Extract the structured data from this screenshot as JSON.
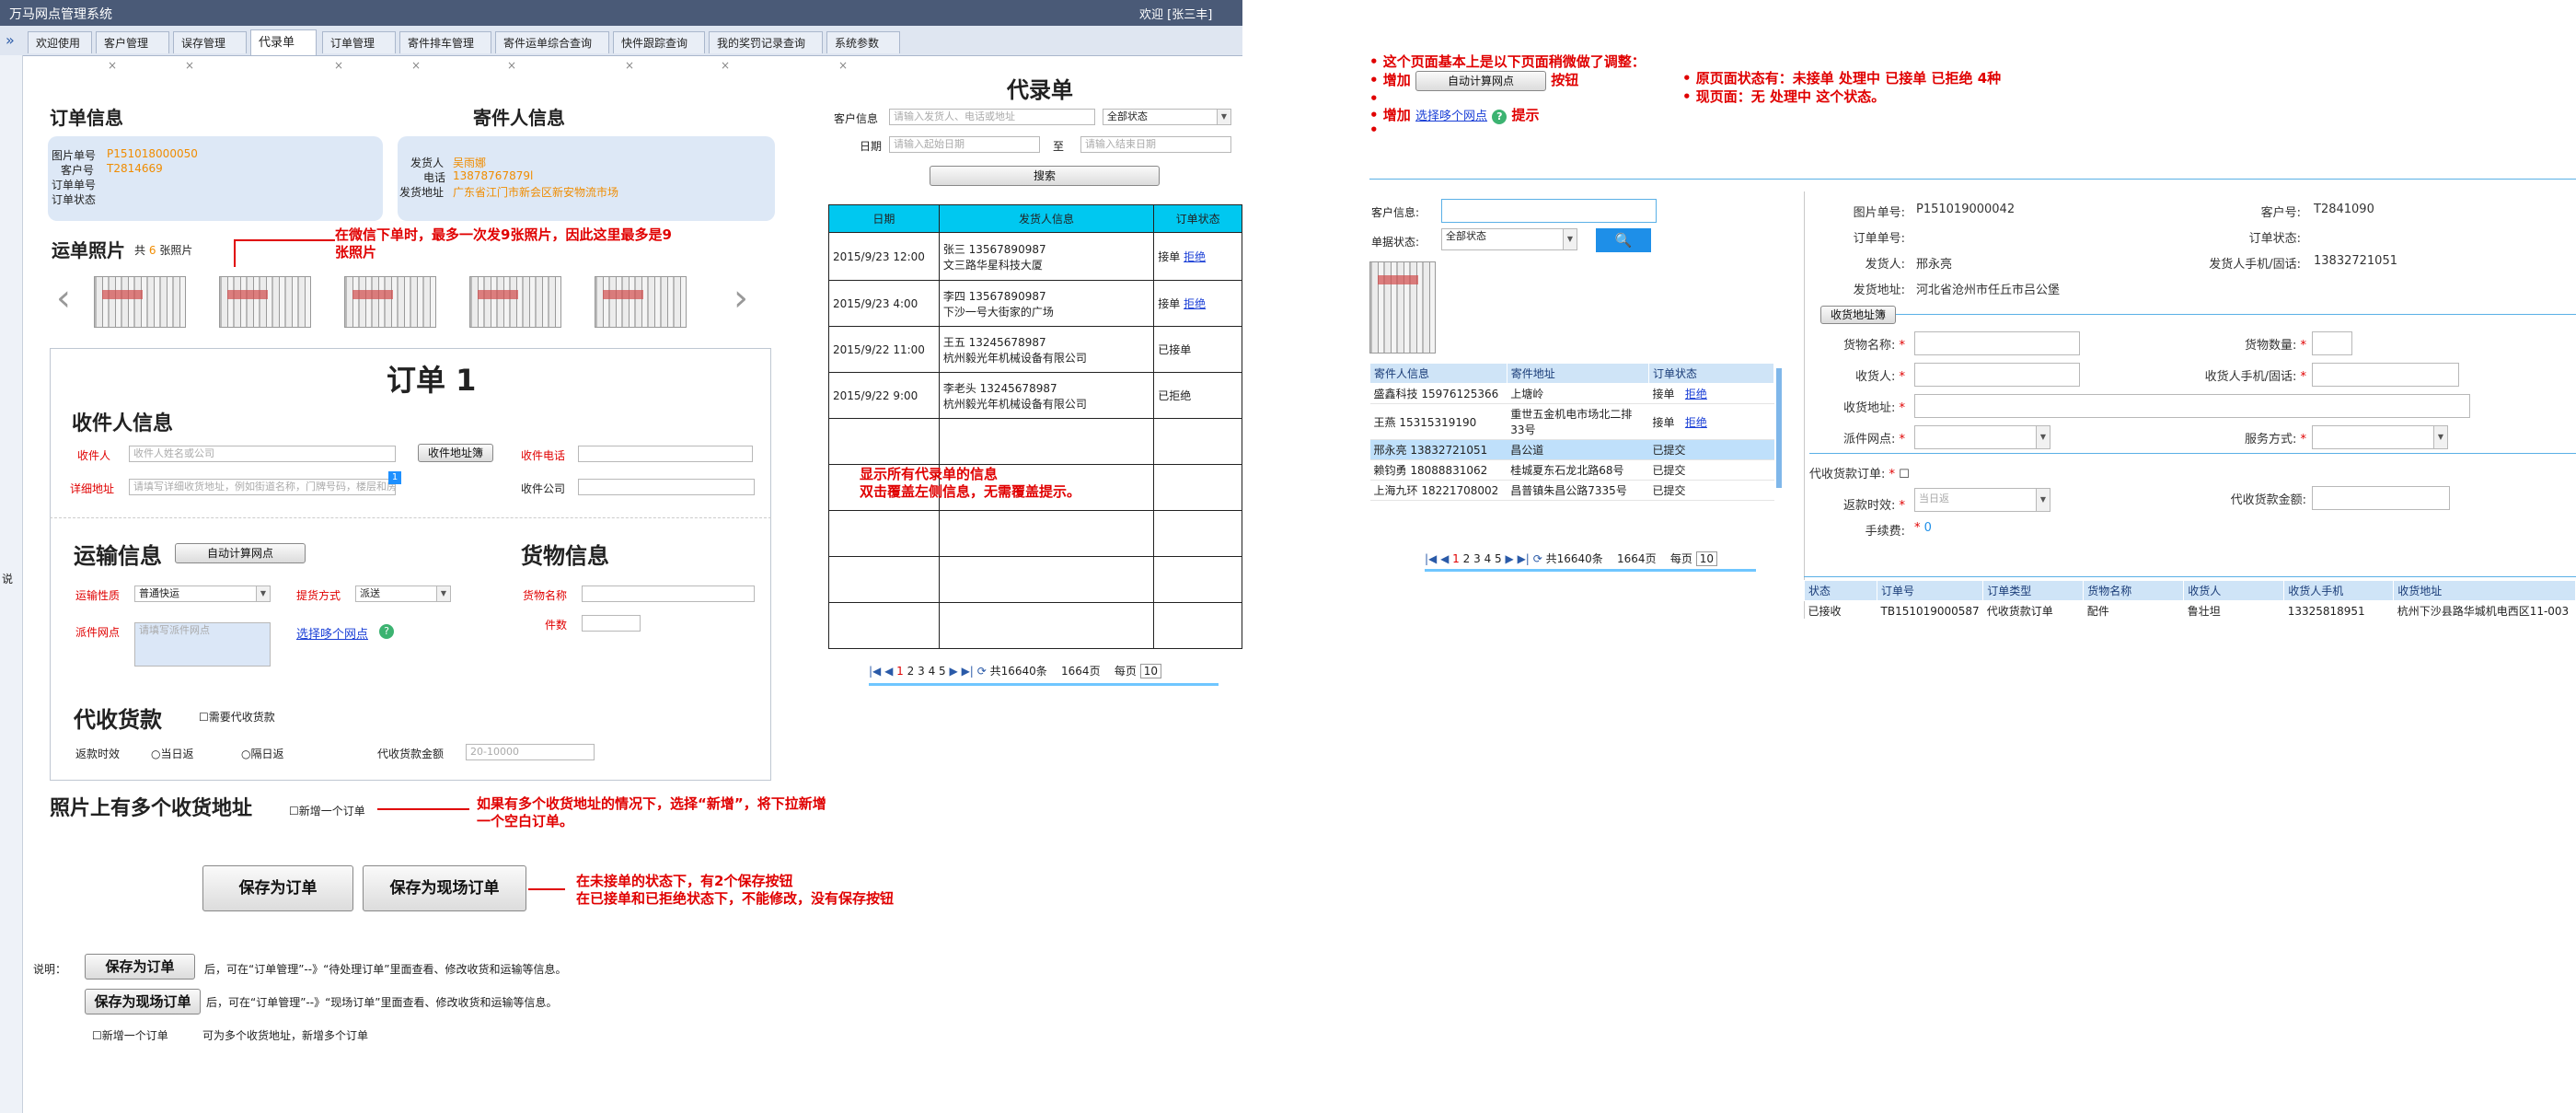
{
  "header": {
    "app_title": "万马网点管理系统",
    "welcome": "欢迎 [张三丰]"
  },
  "tabs": [
    {
      "label": "欢迎使用",
      "close": false
    },
    {
      "label": "客户管理",
      "close": true
    },
    {
      "label": "误存管理",
      "close": true
    },
    {
      "label": "代录单",
      "close": false,
      "active": true
    },
    {
      "label": "订单管理",
      "close": true
    },
    {
      "label": "寄件排车管理",
      "close": true
    },
    {
      "label": "寄件运单综合查询",
      "close": true
    },
    {
      "label": "快件跟踪查询",
      "close": true
    },
    {
      "label": "我的奖罚记录查询",
      "close": true
    },
    {
      "label": "系统参数",
      "close": true
    }
  ],
  "left_strip": {
    "toggle": "»",
    "label": "说"
  },
  "order_info": {
    "title": "订单信息",
    "rows": [
      {
        "label": "图片单号",
        "value": "P151018000050"
      },
      {
        "label": "客户号",
        "value": "T2814669"
      },
      {
        "label": "订单单号",
        "value": ""
      },
      {
        "label": "订单状态",
        "value": ""
      }
    ]
  },
  "sender_info": {
    "title": "寄件人信息",
    "rows": [
      {
        "label": "发货人",
        "value": "吴雨娜"
      },
      {
        "label": "电话",
        "value": "13878767879l"
      },
      {
        "label": "发货地址",
        "value": "广东省江门市新会区新安物流市场"
      }
    ]
  },
  "photos": {
    "title": "运单照片",
    "count_prefix": "共",
    "count": "6",
    "count_suffix": "张照片",
    "prev": "‹",
    "next": "›"
  },
  "annotations": {
    "photos_note": "在微信下单时，最多一次发9张照片，因此这里最多是9张照片",
    "list_note": "显示所有代录单的信息\n双击覆盖左侧信息，无需覆盖提示。",
    "multi_addr_note": "如果有多个收货地址的情况下，选择“新增”，将下拉新增一个空白订单。",
    "save_note": "在未接单的状态下，有2个保存按钮\n在已接单和已拒绝状态下，不能修改，没有保存按钮"
  },
  "order_form": {
    "title": "订单 1",
    "receiver": {
      "title": "收件人信息",
      "name_label": "收件人",
      "name_ph": "收件人姓名或公司",
      "addr_book_btn": "收件地址簿",
      "phone_label": "收件电话",
      "addr_label": "详细地址",
      "addr_ph": "请填写详细收货地址，例如街道名称，门牌号码，楼层和房间号等信息",
      "addr_badge": "1",
      "company_label": "收件公司"
    },
    "transport": {
      "title": "运输信息",
      "calc_btn": "自动计算网点",
      "nature_label": "运输性质",
      "nature_value": "普通快运",
      "pickup_label": "提货方式",
      "pickup_value": "派送",
      "dispatch_label": "派件网点",
      "dispatch_ph": "请填写派件网点",
      "multi_link": "选择哆个网点",
      "help_icon": "?"
    },
    "goods": {
      "title": "货物信息",
      "name_label": "货物名称",
      "qty_label": "件数"
    },
    "cod": {
      "title": "代收货款",
      "need_label": "需要代收货款",
      "return_label": "返款时效",
      "opt1": "当日返",
      "opt2": "隔日返",
      "amount_label": "代收货款金额",
      "amount_ph": "20-10000"
    }
  },
  "multi_addr": {
    "title": "照片上有多个收货地址",
    "check_label": "新增一个订单"
  },
  "buttons": {
    "save_order": "保存为订单",
    "save_onsite": "保存为现场订单"
  },
  "explain": {
    "label": "说明：",
    "btn1": "保存为订单",
    "text1": "后，可在“订单管理”--》“待处理订单”里面查看、修改收货和运输等信息。",
    "btn2": "保存为现场订单",
    "text2": "后，可在“订单管理”--》“现场订单”里面查看、修改收货和运输等信息。",
    "check": "新增一个订单",
    "text3": "可为多个收货地址，新增多个订单"
  },
  "list_panel": {
    "title": "代录单",
    "customer_label": "客户信息",
    "customer_ph": "请输入发货人、电话或地址",
    "status_value": "全部状态",
    "date_label": "日期",
    "date_start_ph": "请输入起始日期",
    "to": "至",
    "date_end_ph": "请输入结束日期",
    "search_btn": "搜索",
    "columns": [
      "日期",
      "发货人信息",
      "订单状态"
    ],
    "rows": [
      {
        "date": "2015/9/23 12:00",
        "line1": "张三 13567890987",
        "line2": "文三路华星科技大厦",
        "status": "接单",
        "reject": "拒绝"
      },
      {
        "date": "2015/9/23 4:00",
        "line1": "李四 13567890987",
        "line2": "下沙一号大街家的广场",
        "status": "接单",
        "reject": "拒绝"
      },
      {
        "date": "2015/9/22 11:00",
        "line1": "王五 13245678987",
        "line2": "杭州毅光年机械设备有限公司",
        "status": "已接单",
        "reject": ""
      },
      {
        "date": "2015/9/22 9:00",
        "line1": "李老头 13245678987",
        "line2": "杭州毅光年机械设备有限公司",
        "status": "已拒绝",
        "reject": ""
      }
    ],
    "pager": {
      "pages": [
        "1",
        "2",
        "3",
        "4",
        "5"
      ],
      "total": "共16640条",
      "page_count": "1664页",
      "per_page_label": "每页",
      "per_page": "10"
    }
  },
  "right_notes": {
    "note1": "• 这个页面基本上是以下页面稍微做了调整：",
    "note2_prefix": "• 增加",
    "note2_btn": "自动计算网点",
    "note2_suffix": "按钮",
    "note3": "•",
    "note4_prefix": "• 增加",
    "note4_link": "选择哆个网点",
    "note4_suffix": "提示",
    "note5": "•",
    "note6": "• 原页面状态有：未接单 处理中 已接单 已拒绝 4种",
    "note7": "• 现页面：无 处理中 这个状态。"
  },
  "old_page": {
    "customer_label": "客户信息:",
    "status_label": "单据状态:",
    "status_value": "全部状态",
    "columns": [
      "寄件人信息",
      "寄件地址",
      "订单状态"
    ],
    "rows": [
      {
        "info": "盛鑫科技 15976125366",
        "addr": "上塘岭",
        "status": "接单",
        "reject": "拒绝"
      },
      {
        "info": "王燕 15315319190",
        "addr": "重世五金机电市场北二排33号",
        "status": "接单",
        "reject": "拒绝"
      },
      {
        "info": "邢永亮 13832721051",
        "addr": "昌公道",
        "status": "已提交",
        "reject": ""
      },
      {
        "info": "赖钧勇 18088831062",
        "addr": "桂城夏东石龙北路68号",
        "status": "已提交",
        "reject": ""
      },
      {
        "info": "上海九环 18221708002",
        "addr": "昌普镇朱昌公路7335号",
        "status": "已提交",
        "reject": ""
      }
    ],
    "pager": {
      "pages": [
        "1",
        "2",
        "3",
        "4",
        "5"
      ],
      "total": "共16640条",
      "page_count": "1664页",
      "per_page_label": "每页",
      "per_page": "10"
    },
    "detail": {
      "pic_no_label": "图片单号:",
      "pic_no": "P151019000042",
      "cust_label": "客户号:",
      "cust": "T2841090",
      "order_no_label": "订单单号:",
      "order_status_label": "订单状态:",
      "sender_label": "发货人:",
      "sender": "邢永亮",
      "sender_phone_label": "发货人手机/固话:",
      "sender_phone": "13832721051",
      "sender_addr_label": "发货地址:",
      "sender_addr": "河北省沧州市任丘市吕公堡",
      "addr_book": "收货地址簿",
      "goods_name_label": "货物名称:",
      "goods_qty_label": "货物数量:",
      "receiver_label": "收货人:",
      "receiver_phone_label": "收货人手机/固话:",
      "receiver_addr_label": "收货地址:",
      "dispatch_label": "派件网点:",
      "service_label": "服务方式:",
      "cod_label": "代收货款订单:",
      "return_label": "返款时效:",
      "return_ph": "当日返",
      "cod_amount_label": "代收货款金额:",
      "fee_label": "手续费:",
      "fee": "0"
    },
    "bottom_columns": [
      "状态",
      "订单号",
      "订单类型",
      "货物名称",
      "收货人",
      "收货人手机",
      "收货地址"
    ],
    "bottom_row": [
      "已接收",
      "TB151019000587",
      "代收货款订单",
      "配件",
      "鲁壮坦",
      "13325818951",
      "杭州下沙县路华城机电西区11-003"
    ]
  }
}
